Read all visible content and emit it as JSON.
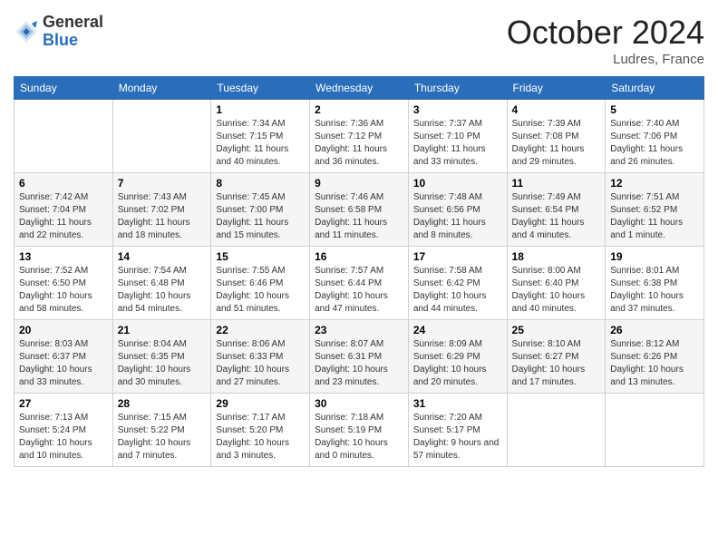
{
  "header": {
    "logo_general": "General",
    "logo_blue": "Blue",
    "month_title": "October 2024",
    "location": "Ludres, France"
  },
  "days_of_week": [
    "Sunday",
    "Monday",
    "Tuesday",
    "Wednesday",
    "Thursday",
    "Friday",
    "Saturday"
  ],
  "weeks": [
    [
      {
        "day": "",
        "info": ""
      },
      {
        "day": "",
        "info": ""
      },
      {
        "day": "1",
        "info": "Sunrise: 7:34 AM\nSunset: 7:15 PM\nDaylight: 11 hours and 40 minutes."
      },
      {
        "day": "2",
        "info": "Sunrise: 7:36 AM\nSunset: 7:12 PM\nDaylight: 11 hours and 36 minutes."
      },
      {
        "day": "3",
        "info": "Sunrise: 7:37 AM\nSunset: 7:10 PM\nDaylight: 11 hours and 33 minutes."
      },
      {
        "day": "4",
        "info": "Sunrise: 7:39 AM\nSunset: 7:08 PM\nDaylight: 11 hours and 29 minutes."
      },
      {
        "day": "5",
        "info": "Sunrise: 7:40 AM\nSunset: 7:06 PM\nDaylight: 11 hours and 26 minutes."
      }
    ],
    [
      {
        "day": "6",
        "info": "Sunrise: 7:42 AM\nSunset: 7:04 PM\nDaylight: 11 hours and 22 minutes."
      },
      {
        "day": "7",
        "info": "Sunrise: 7:43 AM\nSunset: 7:02 PM\nDaylight: 11 hours and 18 minutes."
      },
      {
        "day": "8",
        "info": "Sunrise: 7:45 AM\nSunset: 7:00 PM\nDaylight: 11 hours and 15 minutes."
      },
      {
        "day": "9",
        "info": "Sunrise: 7:46 AM\nSunset: 6:58 PM\nDaylight: 11 hours and 11 minutes."
      },
      {
        "day": "10",
        "info": "Sunrise: 7:48 AM\nSunset: 6:56 PM\nDaylight: 11 hours and 8 minutes."
      },
      {
        "day": "11",
        "info": "Sunrise: 7:49 AM\nSunset: 6:54 PM\nDaylight: 11 hours and 4 minutes."
      },
      {
        "day": "12",
        "info": "Sunrise: 7:51 AM\nSunset: 6:52 PM\nDaylight: 11 hours and 1 minute."
      }
    ],
    [
      {
        "day": "13",
        "info": "Sunrise: 7:52 AM\nSunset: 6:50 PM\nDaylight: 10 hours and 58 minutes."
      },
      {
        "day": "14",
        "info": "Sunrise: 7:54 AM\nSunset: 6:48 PM\nDaylight: 10 hours and 54 minutes."
      },
      {
        "day": "15",
        "info": "Sunrise: 7:55 AM\nSunset: 6:46 PM\nDaylight: 10 hours and 51 minutes."
      },
      {
        "day": "16",
        "info": "Sunrise: 7:57 AM\nSunset: 6:44 PM\nDaylight: 10 hours and 47 minutes."
      },
      {
        "day": "17",
        "info": "Sunrise: 7:58 AM\nSunset: 6:42 PM\nDaylight: 10 hours and 44 minutes."
      },
      {
        "day": "18",
        "info": "Sunrise: 8:00 AM\nSunset: 6:40 PM\nDaylight: 10 hours and 40 minutes."
      },
      {
        "day": "19",
        "info": "Sunrise: 8:01 AM\nSunset: 6:38 PM\nDaylight: 10 hours and 37 minutes."
      }
    ],
    [
      {
        "day": "20",
        "info": "Sunrise: 8:03 AM\nSunset: 6:37 PM\nDaylight: 10 hours and 33 minutes."
      },
      {
        "day": "21",
        "info": "Sunrise: 8:04 AM\nSunset: 6:35 PM\nDaylight: 10 hours and 30 minutes."
      },
      {
        "day": "22",
        "info": "Sunrise: 8:06 AM\nSunset: 6:33 PM\nDaylight: 10 hours and 27 minutes."
      },
      {
        "day": "23",
        "info": "Sunrise: 8:07 AM\nSunset: 6:31 PM\nDaylight: 10 hours and 23 minutes."
      },
      {
        "day": "24",
        "info": "Sunrise: 8:09 AM\nSunset: 6:29 PM\nDaylight: 10 hours and 20 minutes."
      },
      {
        "day": "25",
        "info": "Sunrise: 8:10 AM\nSunset: 6:27 PM\nDaylight: 10 hours and 17 minutes."
      },
      {
        "day": "26",
        "info": "Sunrise: 8:12 AM\nSunset: 6:26 PM\nDaylight: 10 hours and 13 minutes."
      }
    ],
    [
      {
        "day": "27",
        "info": "Sunrise: 7:13 AM\nSunset: 5:24 PM\nDaylight: 10 hours and 10 minutes."
      },
      {
        "day": "28",
        "info": "Sunrise: 7:15 AM\nSunset: 5:22 PM\nDaylight: 10 hours and 7 minutes."
      },
      {
        "day": "29",
        "info": "Sunrise: 7:17 AM\nSunset: 5:20 PM\nDaylight: 10 hours and 3 minutes."
      },
      {
        "day": "30",
        "info": "Sunrise: 7:18 AM\nSunset: 5:19 PM\nDaylight: 10 hours and 0 minutes."
      },
      {
        "day": "31",
        "info": "Sunrise: 7:20 AM\nSunset: 5:17 PM\nDaylight: 9 hours and 57 minutes."
      },
      {
        "day": "",
        "info": ""
      },
      {
        "day": "",
        "info": ""
      }
    ]
  ]
}
